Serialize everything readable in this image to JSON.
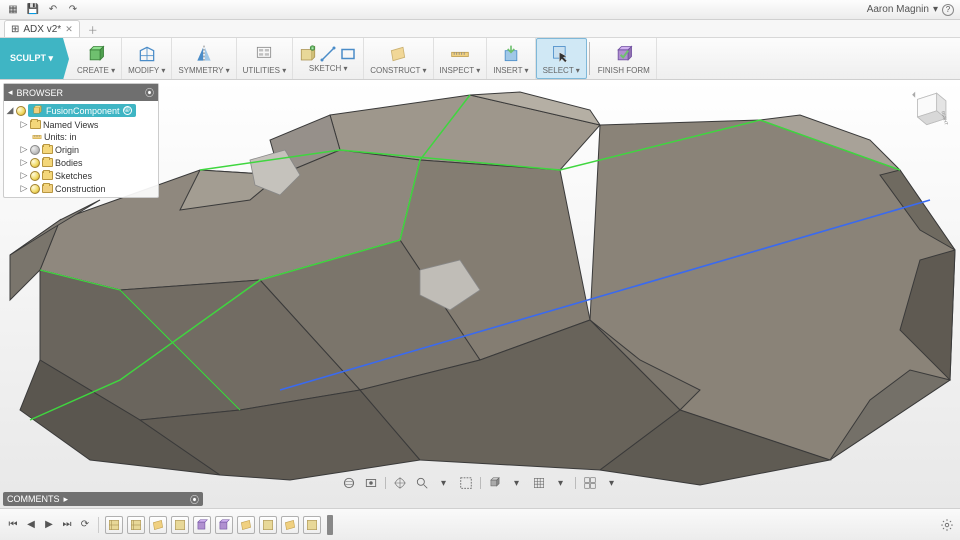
{
  "titlebar": {
    "user_name": "Aaron Magnin",
    "help_icon": "?"
  },
  "tabs": {
    "active": {
      "icon": "⊞",
      "label": "ADX v2*"
    }
  },
  "ribbon": {
    "workspace": "SCULPT ▾",
    "groups": [
      {
        "label": "CREATE ▾"
      },
      {
        "label": "MODIFY ▾"
      },
      {
        "label": "SYMMETRY ▾"
      },
      {
        "label": "UTILITIES ▾"
      },
      {
        "label": "SKETCH ▾"
      },
      {
        "label": "CONSTRUCT ▾"
      },
      {
        "label": "INSPECT ▾"
      },
      {
        "label": "INSERT ▾"
      },
      {
        "label": "SELECT ▾"
      },
      {
        "label": "FINISH FORM"
      }
    ]
  },
  "browser": {
    "title": "BROWSER",
    "root": "FusionComponent",
    "items": [
      {
        "label": "Named Views",
        "bulb": false,
        "folder": true
      },
      {
        "label": "Units: in",
        "bulb": false,
        "folder": false,
        "indent": 2
      },
      {
        "label": "Origin",
        "bulb": true,
        "folder": true
      },
      {
        "label": "Bodies",
        "bulb": true,
        "folder": true
      },
      {
        "label": "Sketches",
        "bulb": true,
        "folder": true
      },
      {
        "label": "Construction",
        "bulb": true,
        "folder": true
      }
    ]
  },
  "comments": {
    "title": "COMMENTS"
  },
  "viewcube": {
    "face": "RIGHT"
  },
  "timeline": {
    "playback": [
      "⏮",
      "◀",
      "▶",
      "⏭",
      "⟳"
    ],
    "features_count": 10
  }
}
